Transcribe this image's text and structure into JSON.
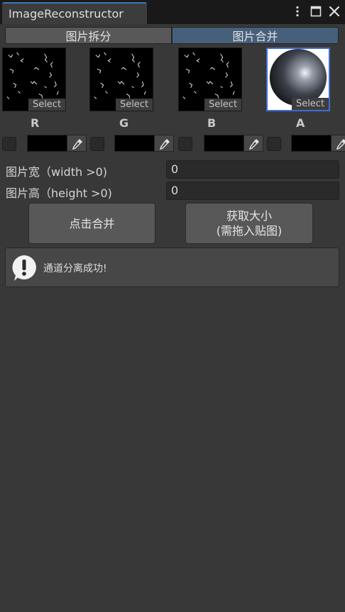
{
  "window": {
    "title": "ImageReconstructor",
    "menu_icon": "kebab-menu-icon",
    "maximize_icon": "maximize-icon",
    "close_icon": "close-icon"
  },
  "toolbar": {
    "tabs": [
      {
        "label": "图片拆分",
        "selected": false
      },
      {
        "label": "图片合并",
        "selected": true
      }
    ]
  },
  "slots": [
    {
      "channel": "R",
      "select_label": "Select",
      "color": "#000000"
    },
    {
      "channel": "G",
      "select_label": "Select",
      "color": "#000000"
    },
    {
      "channel": "B",
      "select_label": "Select",
      "color": "#000000"
    },
    {
      "channel": "A",
      "select_label": "Select",
      "color": "#000000"
    }
  ],
  "fields": {
    "width": {
      "label": "图片宽（width >0)",
      "value": "0"
    },
    "height": {
      "label": "图片高（height >0)",
      "value": "0"
    }
  },
  "buttons": {
    "merge": "点击合并",
    "get_size_line1": "获取大小",
    "get_size_line2": "(需拖入贴图)"
  },
  "message": {
    "icon": "info-exclamation-icon",
    "text": "通道分离成功!"
  },
  "colors": {
    "accent_tab": "#46607c",
    "selected_slot_border": "#3f6cd8",
    "title_accent": "#3a79bb"
  }
}
